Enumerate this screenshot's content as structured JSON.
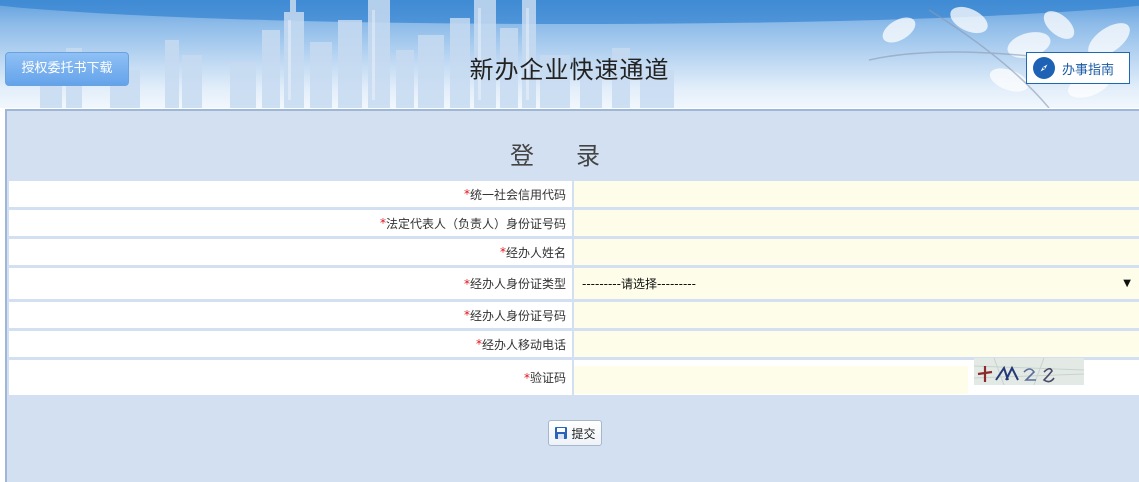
{
  "header": {
    "download_label": "授权委托书下载",
    "title": "新办企业快速通道",
    "guide_label": "办事指南",
    "guide_icon": "compass-icon"
  },
  "login": {
    "title": "登录",
    "fields": [
      {
        "label": "统一社会信用代码",
        "value": ""
      },
      {
        "label": "法定代表人（负责人）身份证号码",
        "value": ""
      },
      {
        "label": "经办人姓名",
        "value": ""
      },
      {
        "label": "经办人身份证类型",
        "value": "---------请选择---------"
      },
      {
        "label": "经办人身份证号码",
        "value": ""
      },
      {
        "label": "经办人移动电话",
        "value": ""
      },
      {
        "label": "验证码",
        "value": ""
      }
    ],
    "required_mark": "*",
    "submit_label": "提交",
    "submit_icon": "save-icon"
  },
  "colors": {
    "panel_bg": "#d2e0f1",
    "input_bg": "#fdfdea",
    "required": "#e0121a",
    "guide_border": "#1e69b3"
  }
}
